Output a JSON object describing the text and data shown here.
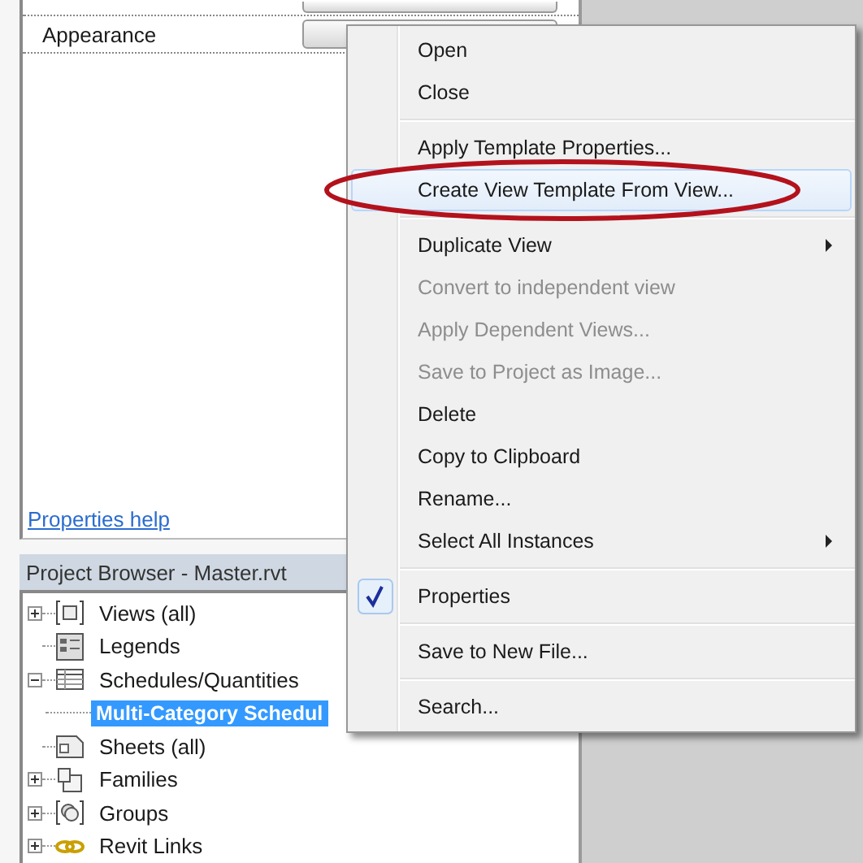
{
  "properties": {
    "rows": [
      {
        "label": "Appearance"
      }
    ],
    "help_link": "Properties help"
  },
  "project_browser": {
    "title": "Project Browser - Master.rvt",
    "tree": [
      {
        "label": "Views (all)",
        "kind": "views",
        "expanded": false,
        "selected": false
      },
      {
        "label": "Legends",
        "kind": "legends",
        "selected": false
      },
      {
        "label": "Schedules/Quantities",
        "kind": "schedules",
        "expanded": true,
        "selected": false,
        "children": [
          {
            "label": "Multi-Category Schedul",
            "selected": true
          }
        ]
      },
      {
        "label": "Sheets (all)",
        "kind": "sheets",
        "selected": false
      },
      {
        "label": "Families",
        "kind": "families",
        "expanded": false,
        "selected": false
      },
      {
        "label": "Groups",
        "kind": "groups",
        "expanded": false,
        "selected": false
      },
      {
        "label": "Revit Links",
        "kind": "links",
        "expanded": false,
        "selected": false
      }
    ]
  },
  "context_menu": {
    "items": [
      {
        "kind": "item",
        "label": "Open",
        "disabled": false,
        "selected": false,
        "submenu": false,
        "checked": false
      },
      {
        "kind": "item",
        "label": "Close",
        "disabled": false,
        "selected": false,
        "submenu": false,
        "checked": false
      },
      {
        "kind": "separator"
      },
      {
        "kind": "item",
        "label": "Apply Template Properties...",
        "disabled": false,
        "selected": false,
        "submenu": false,
        "checked": false
      },
      {
        "kind": "item",
        "label": "Create View Template From View...",
        "disabled": false,
        "selected": true,
        "submenu": false,
        "checked": false
      },
      {
        "kind": "separator"
      },
      {
        "kind": "item",
        "label": "Duplicate View",
        "disabled": false,
        "selected": false,
        "submenu": true,
        "checked": false
      },
      {
        "kind": "item",
        "label": "Convert to independent view",
        "disabled": true,
        "selected": false,
        "submenu": false,
        "checked": false
      },
      {
        "kind": "item",
        "label": "Apply Dependent Views...",
        "disabled": true,
        "selected": false,
        "submenu": false,
        "checked": false
      },
      {
        "kind": "item",
        "label": "Save to Project as Image...",
        "disabled": true,
        "selected": false,
        "submenu": false,
        "checked": false
      },
      {
        "kind": "item",
        "label": "Delete",
        "disabled": false,
        "selected": false,
        "submenu": false,
        "checked": false
      },
      {
        "kind": "item",
        "label": "Copy to Clipboard",
        "disabled": false,
        "selected": false,
        "submenu": false,
        "checked": false
      },
      {
        "kind": "item",
        "label": "Rename...",
        "disabled": false,
        "selected": false,
        "submenu": false,
        "checked": false
      },
      {
        "kind": "item",
        "label": "Select All Instances",
        "disabled": false,
        "selected": false,
        "submenu": true,
        "checked": false
      },
      {
        "kind": "separator"
      },
      {
        "kind": "item",
        "label": "Properties",
        "disabled": false,
        "selected": false,
        "submenu": false,
        "checked": true
      },
      {
        "kind": "separator"
      },
      {
        "kind": "item",
        "label": "Save to New File...",
        "disabled": false,
        "selected": false,
        "submenu": false,
        "checked": false
      },
      {
        "kind": "separator"
      },
      {
        "kind": "item",
        "label": "Search...",
        "disabled": false,
        "selected": false,
        "submenu": false,
        "checked": false
      }
    ]
  }
}
